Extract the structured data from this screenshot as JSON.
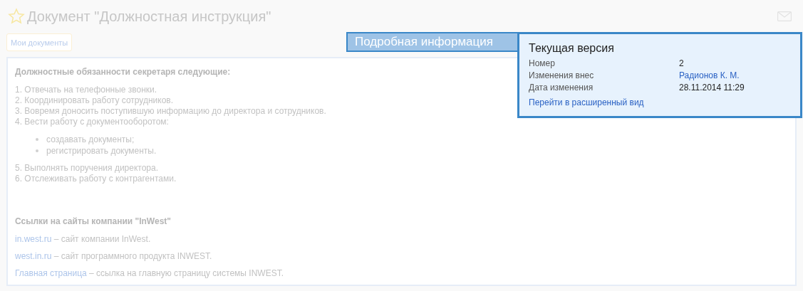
{
  "title": "Документ \"Должностная инструкция\"",
  "my_documents_button": "Мои документы",
  "content": {
    "heading": "Должностные обязанности секретаря следующие:",
    "items": [
      {
        "kind": "line",
        "text": "1. Отвечать на телефонные звонки."
      },
      {
        "kind": "line",
        "text": "2. Координировать работу сотрудников."
      },
      {
        "kind": "line",
        "text": "3. Вовремя доносить поступившую информацию до директора и сотрудников."
      },
      {
        "kind": "line",
        "text": "4. Вести работу с документооборотом:"
      },
      {
        "kind": "bullet",
        "text": "создавать документы;"
      },
      {
        "kind": "bullet",
        "text": "регистрировать документы."
      },
      {
        "kind": "line",
        "text": "5. Выполнять поручения директора."
      },
      {
        "kind": "line",
        "text": "6. Отслеживать работу с контрагентами."
      }
    ],
    "links_heading": "Ссылки на сайты компании \"InWest\"",
    "links": [
      {
        "link": "in.west.ru",
        "text": " – сайт компании InWest."
      },
      {
        "link": "west.in.ru",
        "text": " – сайт программного продукта INWEST."
      },
      {
        "link": "Главная страница",
        "text": " – ссылка на главную страницу системы INWEST."
      }
    ]
  },
  "details_tab": "Подробная информация",
  "popup": {
    "title": "Текущая версия",
    "fields": [
      {
        "label": "Номер",
        "value": "2",
        "kind": "text"
      },
      {
        "label": "Изменения внес",
        "value": "Радионов К. М.",
        "kind": "link"
      },
      {
        "label": "Дата изменения",
        "value": "28.11.2014 11:29",
        "kind": "text"
      }
    ],
    "link": "Перейти в расширенный вид"
  }
}
